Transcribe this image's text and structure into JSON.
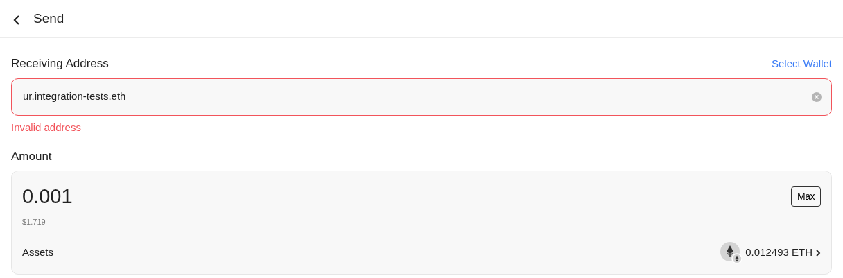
{
  "header": {
    "title": "Send"
  },
  "receiving_address": {
    "label": "Receiving Address",
    "link": "Select Wallet",
    "value": "ur.integration-tests.eth",
    "invalid": true,
    "error": "Invalid address"
  },
  "amount": {
    "label": "Amount",
    "value": "0.001",
    "fiat": "$1.719",
    "max_button": "Max",
    "assets_label": "Assets",
    "balance": "0.012493 ETH"
  }
}
